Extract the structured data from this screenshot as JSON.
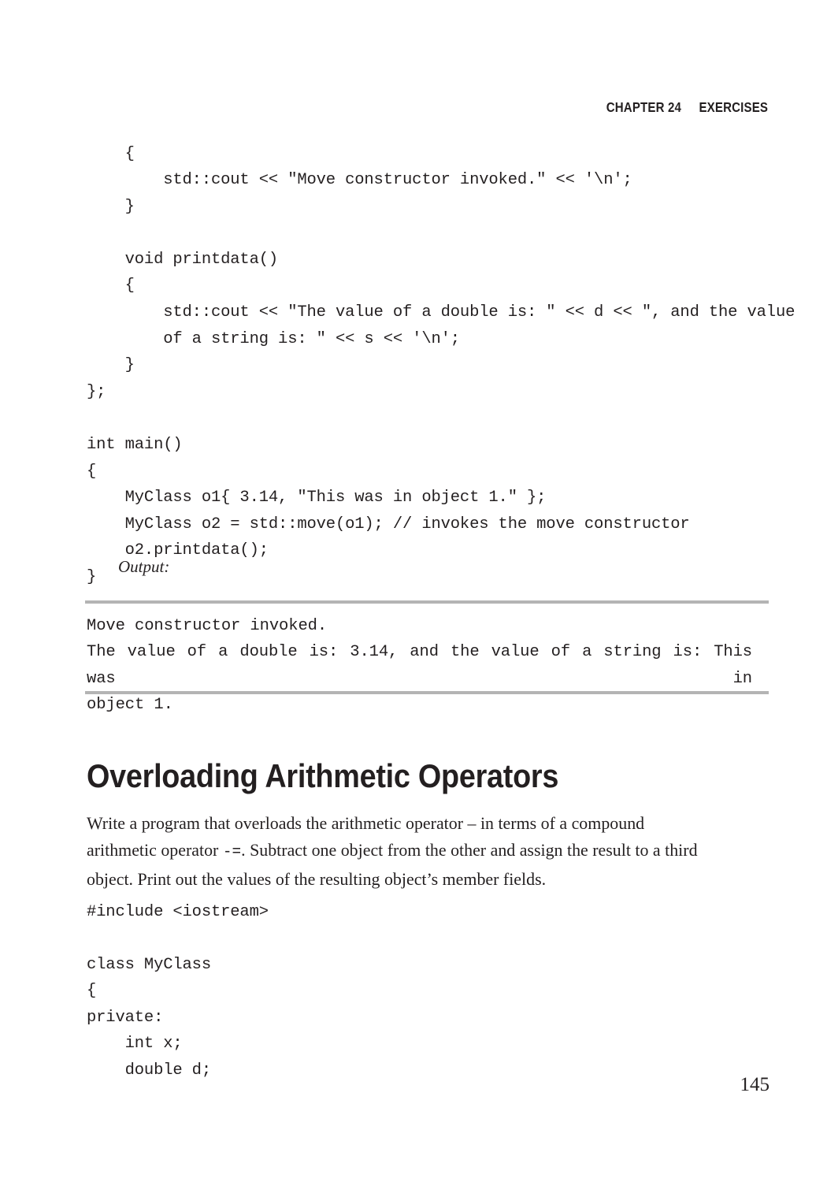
{
  "header": {
    "chapter": "CHAPTER 24",
    "section": "EXERCISES"
  },
  "code_block_1": {
    "lines": [
      "    {",
      "        std::cout << \"Move constructor invoked.\" << '\\n';",
      "    }",
      "",
      "    void printdata()",
      "    {",
      "        std::cout << \"The value of a double is: \" << d << \", and the value",
      "        of a string is: \" << s << '\\n';",
      "    }",
      "};",
      "",
      "int main()",
      "{",
      "    MyClass o1{ 3.14, \"This was in object 1.\" };",
      "    MyClass o2 = std::move(o1); // invokes the move constructor",
      "    o2.printdata();",
      "}"
    ]
  },
  "output": {
    "caption": "Output:",
    "line_1": "Move constructor invoked.",
    "line_2_justified": "The value of a double is: 3.14, and the value of a string is: This was in",
    "line_3": "object 1."
  },
  "section": {
    "heading": "Overloading Arithmetic Operators",
    "paragraph_part_1": "Write a program that overloads the arithmetic operator – in terms of a compound arithmetic operator ",
    "paragraph_operator": "-=",
    "paragraph_part_2": ". Subtract one object from the other and assign the result to a third object. Print out the values of the resulting object’s member fields."
  },
  "code_block_2": {
    "lines": [
      "#include <iostream>",
      "",
      "class MyClass",
      "{",
      "private:",
      "    int x;",
      "    double d;"
    ]
  },
  "folio": {
    "page_number": "145"
  }
}
